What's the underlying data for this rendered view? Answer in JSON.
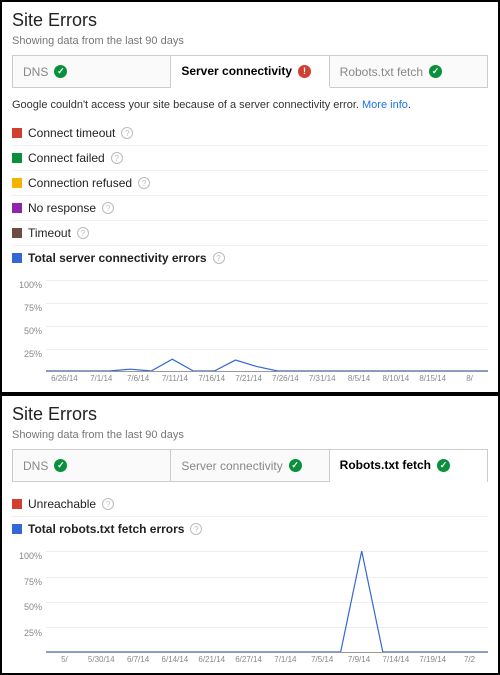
{
  "panel1": {
    "title": "Site Errors",
    "subtitle": "Showing data from the last 90 days",
    "tabs": [
      {
        "label": "DNS",
        "status": "ok",
        "active": false
      },
      {
        "label": "Server connectivity",
        "status": "err",
        "active": true
      },
      {
        "label": "Robots.txt fetch",
        "status": "ok",
        "active": false
      }
    ],
    "message": "Google couldn't access your site because of a server connectivity error.",
    "more_link": "More info",
    "legend": [
      {
        "label": "Connect timeout",
        "color": "#d23f31",
        "bold": false
      },
      {
        "label": "Connect failed",
        "color": "#0a8f3c",
        "bold": false
      },
      {
        "label": "Connection refused",
        "color": "#f4b400",
        "bold": false
      },
      {
        "label": "No response",
        "color": "#8e24aa",
        "bold": false
      },
      {
        "label": "Timeout",
        "color": "#6d4c41",
        "bold": false
      },
      {
        "label": "Total server connectivity errors",
        "color": "#3367d6",
        "bold": true
      }
    ]
  },
  "panel2": {
    "title": "Site Errors",
    "subtitle": "Showing data from the last 90 days",
    "tabs": [
      {
        "label": "DNS",
        "status": "ok",
        "active": false
      },
      {
        "label": "Server connectivity",
        "status": "ok",
        "active": false
      },
      {
        "label": "Robots.txt fetch",
        "status": "ok",
        "active": true
      }
    ],
    "legend": [
      {
        "label": "Unreachable",
        "color": "#d23f31",
        "bold": false
      },
      {
        "label": "Total robots.txt fetch errors",
        "color": "#3367d6",
        "bold": true
      }
    ]
  },
  "chart_data": [
    {
      "type": "line",
      "title": "Total server connectivity errors",
      "ylabel": "%",
      "ylim": [
        0,
        100
      ],
      "yticks": [
        25,
        50,
        75,
        100
      ],
      "categories": [
        "6/26/14",
        "7/1/14",
        "7/6/14",
        "7/11/14",
        "7/16/14",
        "7/21/14",
        "7/26/14",
        "7/31/14",
        "8/5/14",
        "8/10/14",
        "8/15/14",
        "8/"
      ],
      "series": [
        {
          "name": "Total server connectivity errors",
          "color": "#3367d6",
          "values": [
            0,
            0,
            0,
            0,
            2,
            0,
            13,
            0,
            0,
            12,
            5,
            0,
            0,
            0,
            0,
            0,
            0,
            0,
            0,
            0,
            0,
            0
          ]
        }
      ]
    },
    {
      "type": "line",
      "title": "Total robots.txt fetch errors",
      "ylabel": "%",
      "ylim": [
        0,
        100
      ],
      "yticks": [
        25,
        50,
        75,
        100
      ],
      "categories": [
        "5/",
        "5/30/14",
        "6/7/14",
        "6/14/14",
        "6/21/14",
        "6/27/14",
        "7/1/14",
        "7/5/14",
        "7/9/14",
        "7/14/14",
        "7/19/14",
        "7/2"
      ],
      "series": [
        {
          "name": "Total robots.txt fetch errors",
          "color": "#3367d6",
          "values": [
            0,
            0,
            0,
            0,
            0,
            0,
            0,
            0,
            0,
            0,
            0,
            0,
            0,
            0,
            0,
            100,
            0,
            0,
            0,
            0,
            0,
            0
          ]
        }
      ]
    }
  ]
}
